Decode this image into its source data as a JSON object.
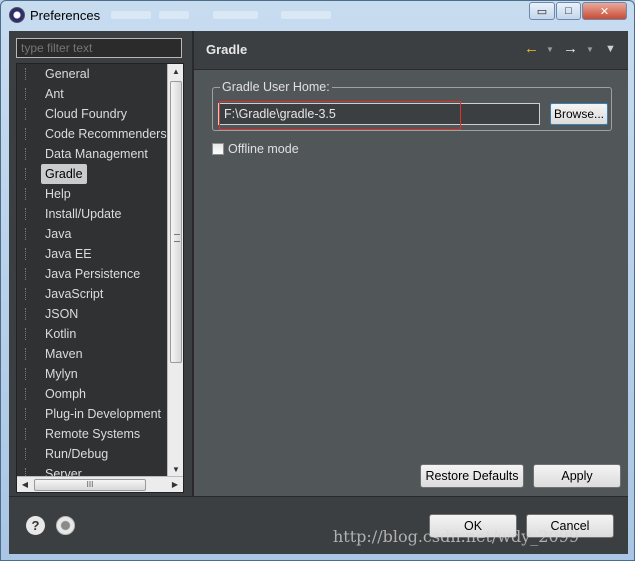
{
  "window": {
    "title": "Preferences",
    "buttons": {
      "minimize": "▭",
      "maximize": "□",
      "close": "✕"
    }
  },
  "sidebar": {
    "filter_placeholder": "type filter text",
    "items": [
      {
        "label": "General"
      },
      {
        "label": "Ant"
      },
      {
        "label": "Cloud Foundry"
      },
      {
        "label": "Code Recommenders"
      },
      {
        "label": "Data Management"
      },
      {
        "label": "Gradle",
        "selected": true
      },
      {
        "label": "Help"
      },
      {
        "label": "Install/Update"
      },
      {
        "label": "Java"
      },
      {
        "label": "Java EE"
      },
      {
        "label": "Java Persistence"
      },
      {
        "label": "JavaScript"
      },
      {
        "label": "JSON"
      },
      {
        "label": "Kotlin"
      },
      {
        "label": "Maven"
      },
      {
        "label": "Mylyn"
      },
      {
        "label": "Oomph"
      },
      {
        "label": "Plug-in Development"
      },
      {
        "label": "Remote Systems"
      },
      {
        "label": "Run/Debug"
      },
      {
        "label": "Server"
      }
    ],
    "hscroll_grip": "III"
  },
  "page": {
    "title": "Gradle",
    "back_icon": "←",
    "forward_icon": "→",
    "menu_icon": "▼",
    "group_label": "Gradle User Home:",
    "home_value": "F:\\Gradle\\gradle-3.5",
    "browse_label": "Browse...",
    "offline_label": "Offline mode",
    "offline_checked": false,
    "restore_label": "Restore Defaults",
    "apply_label": "Apply"
  },
  "footer": {
    "help_icon": "?",
    "ok_label": "OK",
    "cancel_label": "Cancel",
    "watermark": "http://blog.csdn.net/wdy_2099"
  },
  "colors": {
    "dark_background": "#3c3f41",
    "panel_background": "#515658",
    "highlight": "#e0302a",
    "back_arrow": "#f0c030"
  }
}
